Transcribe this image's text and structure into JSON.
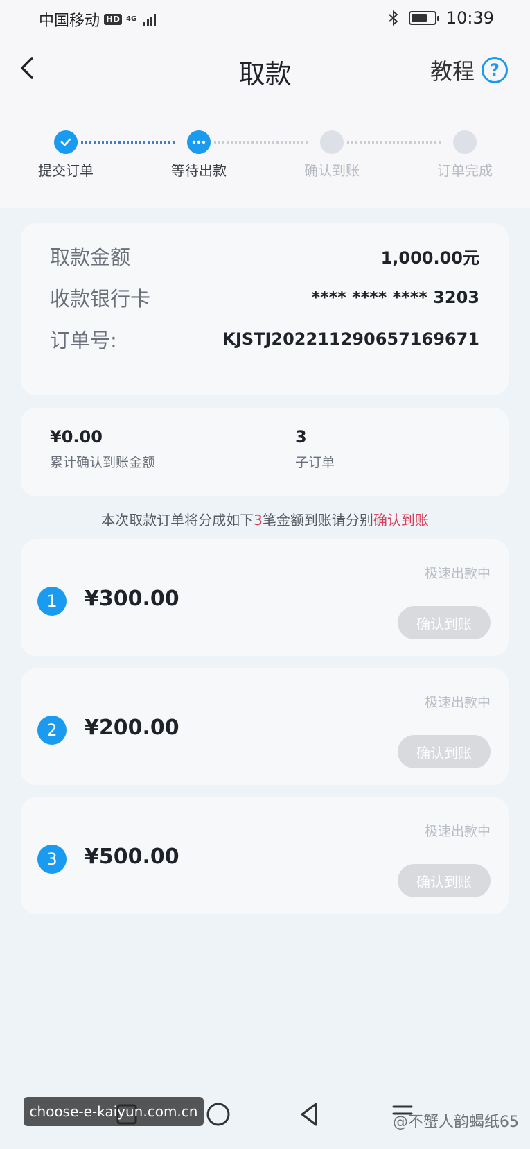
{
  "status_bar": {
    "carrier": "中国移动",
    "hd": "HD",
    "network": "4G",
    "time": "10:39"
  },
  "header": {
    "title": "取款",
    "tutorial_label": "教程",
    "help_symbol": "?"
  },
  "stepper": {
    "steps": [
      {
        "label": "提交订单",
        "state": "done"
      },
      {
        "label": "等待出款",
        "state": "current"
      },
      {
        "label": "确认到账",
        "state": "pending"
      },
      {
        "label": "订单完成",
        "state": "pending"
      }
    ]
  },
  "order_info": {
    "amount_label": "取款金额",
    "amount_value": "1,000.00元",
    "bank_label": "收款银行卡",
    "bank_value": "**** **** **** 3203",
    "order_label": "订单号:",
    "order_value": "KJSTJ20221129065716967​1"
  },
  "summary": {
    "confirmed_amount": "¥0.00",
    "confirmed_label": "累计确认到账金额",
    "sub_count": "3",
    "sub_label": "子订单"
  },
  "notice": {
    "prefix": "本次取款订单将分成如下",
    "count": "3",
    "middle": "笔金额到账请分别",
    "highlight": "确认到账"
  },
  "sub_orders": [
    {
      "index": "1",
      "amount": "¥300.00",
      "status": "极速出款中",
      "button": "确认到账"
    },
    {
      "index": "2",
      "amount": "¥200.00",
      "status": "极速出款中",
      "button": "确认到账"
    },
    {
      "index": "3",
      "amount": "¥500.00",
      "status": "极速出款中",
      "button": "确认到账"
    }
  ],
  "watermarks": {
    "left": "choose-e-kaiyun.com.cn",
    "right": "@不蟹人韵蝎纸65"
  },
  "colors": {
    "accent": "#1a9bf0",
    "highlight": "#d2405a",
    "disabled_button": "#d9dadd"
  }
}
